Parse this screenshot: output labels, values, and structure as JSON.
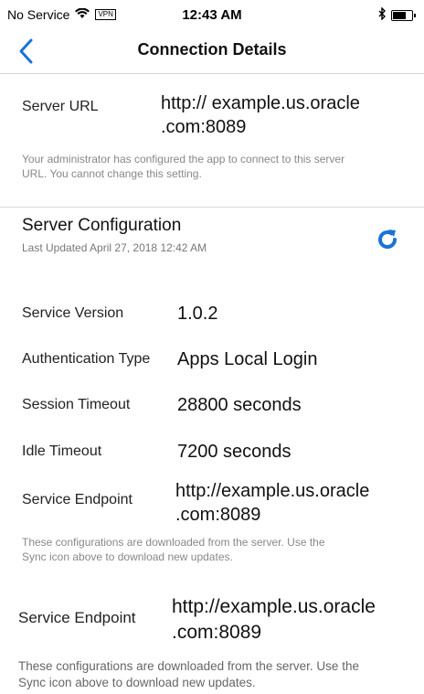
{
  "status_bar": {
    "carrier": "No Service",
    "vpn": "VPN",
    "time": "12:43 AM",
    "battery_level": 0.7
  },
  "nav": {
    "title": "Connection Details"
  },
  "server_url": {
    "label": "Server URL",
    "value_line1": "http:// example.us.oracle",
    "value_line2": ".com:8089",
    "note_line1": "Your administrator has configured the app to connect to this server",
    "note_line2": "URL. You cannot change this setting."
  },
  "server_config": {
    "title": "Server Configuration",
    "last_updated": "Last Updated April 27, 2018 12:42 AM",
    "refresh_icon": "refresh-icon",
    "items": [
      {
        "label": "Service Version",
        "value": "1.0.2"
      },
      {
        "label": "Authentication Type",
        "value": "Apps Local Login"
      },
      {
        "label": "Session Timeout",
        "value": "28800 seconds"
      },
      {
        "label": "Idle Timeout",
        "value": "7200 seconds"
      }
    ],
    "endpoint": {
      "label": "Service Endpoint",
      "value_line1": "http://example.us.oracle",
      "value_line2": ".com:8089"
    },
    "note_line1": "These configurations are downloaded from the server. Use the",
    "note_line2": "Sync icon above to download new updates."
  },
  "endpoint_zoom": {
    "label": "Service Endpoint",
    "value_line1": "http://example.us.oracle",
    "value_line2": ".com:8089",
    "note_line1": "These configurations are downloaded from the server. Use the",
    "note_line2": "Sync icon above to download new updates."
  },
  "colors": {
    "accent": "#1a73d6"
  }
}
